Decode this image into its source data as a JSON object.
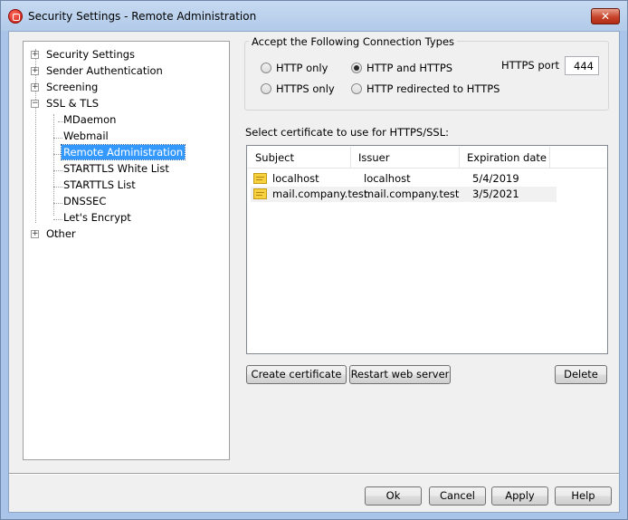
{
  "window": {
    "title": "Security Settings - Remote Administration",
    "close_label": "✕"
  },
  "tree": {
    "items": [
      {
        "label": "Security Settings",
        "expander": "+"
      },
      {
        "label": "Sender Authentication",
        "expander": "+"
      },
      {
        "label": "Screening",
        "expander": "+"
      },
      {
        "label": "SSL & TLS",
        "expander": "−"
      },
      {
        "label": "MDaemon"
      },
      {
        "label": "Webmail"
      },
      {
        "label": "Remote Administration",
        "selected": true
      },
      {
        "label": "STARTTLS White List"
      },
      {
        "label": "STARTTLS List"
      },
      {
        "label": "DNSSEC"
      },
      {
        "label": "Let's Encrypt"
      },
      {
        "label": "Other",
        "expander": "+"
      }
    ]
  },
  "connection": {
    "group_title": "Accept the Following Connection Types",
    "options": [
      {
        "label": "HTTP only",
        "checked": false
      },
      {
        "label": "HTTP and HTTPS",
        "checked": true
      },
      {
        "label": "HTTPS only",
        "checked": false
      },
      {
        "label": "HTTP redirected to HTTPS",
        "checked": false
      }
    ],
    "port_label": "HTTPS port",
    "port_value": "444"
  },
  "certificates": {
    "label": "Select certificate to use for HTTPS/SSL:",
    "columns": [
      "Subject",
      "Issuer",
      "Expiration date"
    ],
    "rows": [
      {
        "subject": "localhost",
        "issuer": "localhost",
        "expires": "5/4/2019"
      },
      {
        "subject": "mail.company.test",
        "issuer": "mail.company.test",
        "expires": "3/5/2021"
      }
    ],
    "create_label": "Create certificate",
    "restart_label": "Restart web server",
    "delete_label": "Delete"
  },
  "footer": {
    "ok_label": "Ok",
    "cancel_label": "Cancel",
    "apply_label": "Apply",
    "help_label": "Help"
  }
}
